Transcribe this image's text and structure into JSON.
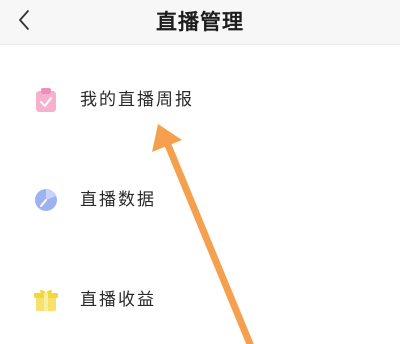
{
  "header": {
    "title": "直播管理",
    "back_icon": "chevron-left-icon"
  },
  "menu": {
    "items": [
      {
        "label": "我的直播周报",
        "icon": "report-icon",
        "icon_color": "#f4a3c6"
      },
      {
        "label": "直播数据",
        "icon": "data-chart-icon",
        "icon_color": "#93a9ef"
      },
      {
        "label": "直播收益",
        "icon": "earnings-gift-icon",
        "icon_color": "#f5e05a"
      }
    ]
  },
  "annotation": {
    "arrow_color": "#f5a04e",
    "points_to": "我的直播周报"
  }
}
